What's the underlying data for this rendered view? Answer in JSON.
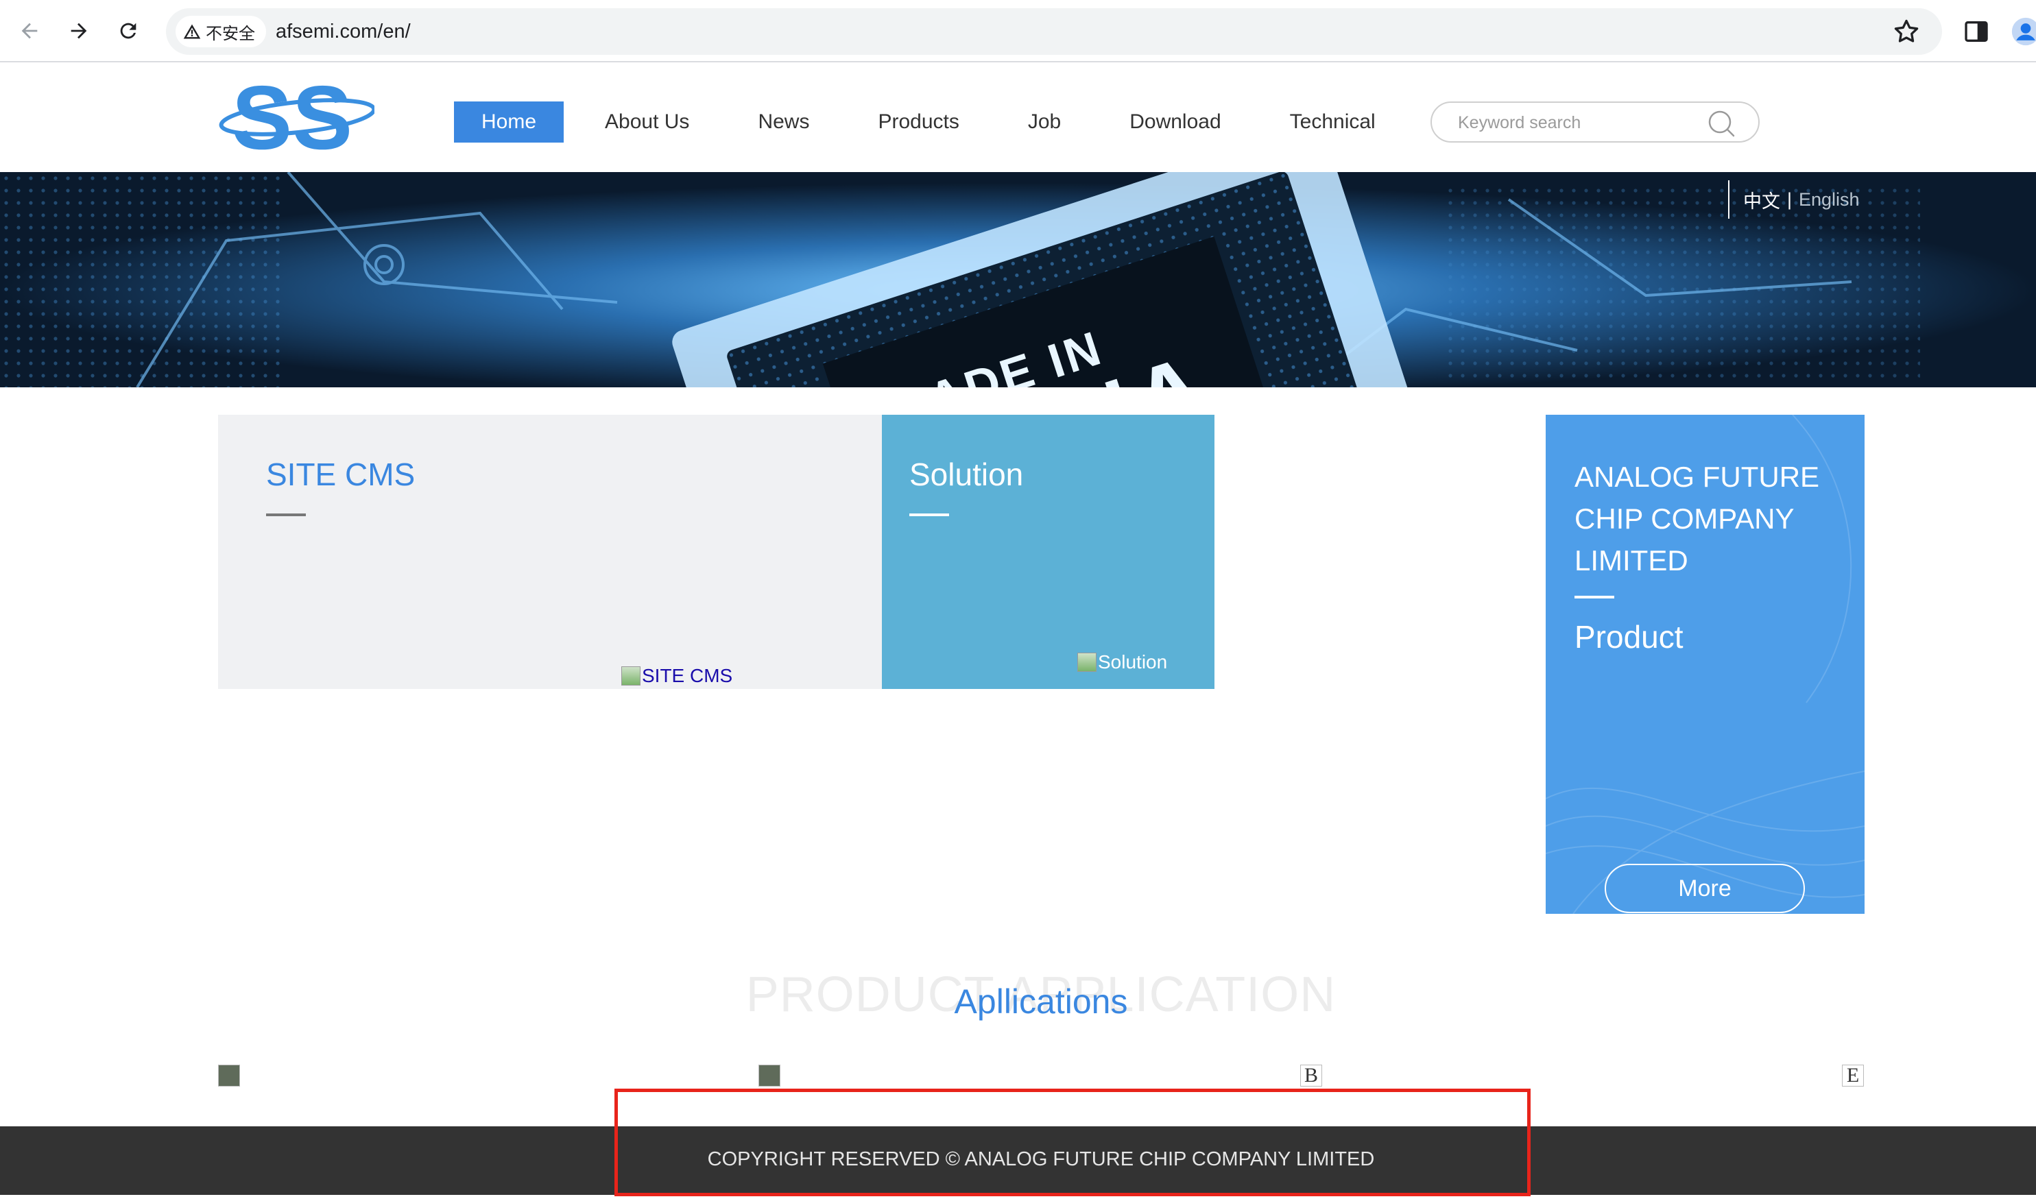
{
  "browser": {
    "security_label": "不安全",
    "url": "afsemi.com/en/",
    "icons": [
      "back-icon",
      "forward-icon",
      "reload-icon",
      "warning-icon",
      "star-icon",
      "side-panel-icon",
      "profile-icon"
    ]
  },
  "header": {
    "logo_text": "SS",
    "nav": [
      {
        "label": "Home",
        "active": true
      },
      {
        "label": "About Us",
        "active": false
      },
      {
        "label": "News",
        "active": false
      },
      {
        "label": "Products",
        "active": false
      },
      {
        "label": "Job",
        "active": false
      },
      {
        "label": "Download",
        "active": false
      },
      {
        "label": "Technical",
        "active": false
      }
    ],
    "search_placeholder": "Keyword search"
  },
  "banner": {
    "image_text": "MADE IN CHINA",
    "lang_zh": "中文",
    "lang_sep": "|",
    "lang_en": "English"
  },
  "cards": {
    "cms": {
      "title": "SITE CMS",
      "image_alt": "SITE CMS"
    },
    "solution": {
      "title": "Solution",
      "image_alt": "Solution"
    },
    "company": {
      "name": "ANALOG FUTURE CHIP COMPANY LIMITED",
      "subtitle": "Product",
      "more_label": "More"
    }
  },
  "applications": {
    "bg_title": "PRODUCT APPLICATION",
    "title": "Apllications",
    "thumb_3_alt": "B",
    "thumb_4_alt": "E"
  },
  "footer": {
    "copyright": "COPYRIGHT RESERVED © ANALOG FUTURE CHIP COMPANY LIMITED"
  },
  "colors": {
    "accent": "#3a87e0",
    "solution_card": "#5cb1d6",
    "company_card": "#4e9ee9",
    "footer_bg": "#333333",
    "highlight": "#e8241b"
  }
}
